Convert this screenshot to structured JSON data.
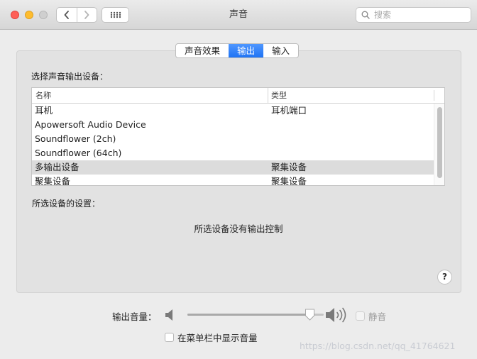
{
  "window": {
    "title": "声音"
  },
  "toolbar": {
    "back_icon": "chevron-left-icon",
    "forward_icon": "chevron-right-icon",
    "grid_icon": "grid-dots-icon"
  },
  "search": {
    "placeholder": "搜索",
    "value": ""
  },
  "tabs": [
    {
      "label": "声音效果",
      "active": false
    },
    {
      "label": "输出",
      "active": true
    },
    {
      "label": "输入",
      "active": false
    }
  ],
  "output": {
    "select_label": "选择声音输出设备：",
    "columns": {
      "name": "名称",
      "type": "类型"
    },
    "devices": [
      {
        "name": "耳机",
        "type": "耳机端口",
        "selected": false
      },
      {
        "name": "Apowersoft Audio Device",
        "type": "",
        "selected": false
      },
      {
        "name": "Soundflower (2ch)",
        "type": "",
        "selected": false
      },
      {
        "name": "Soundflower (64ch)",
        "type": "",
        "selected": false
      },
      {
        "name": "多输出设备",
        "type": "聚集设备",
        "selected": true
      },
      {
        "name": "聚集设备",
        "type": "聚集设备",
        "selected": false
      }
    ],
    "settings_label": "所选设备的设置：",
    "no_controls": "所选设备没有输出控制",
    "help": "?"
  },
  "volume": {
    "label": "输出音量：",
    "level": 0.9,
    "mute_label": "静音",
    "mute_checked": false,
    "show_in_menubar_label": "在菜单栏中显示音量",
    "show_in_menubar_checked": false
  },
  "watermark": "https://blog.csdn.net/qq_41764621",
  "colors": {
    "accent": "#1f73f4",
    "close": "#fe5f57",
    "minimize": "#febc2e"
  }
}
